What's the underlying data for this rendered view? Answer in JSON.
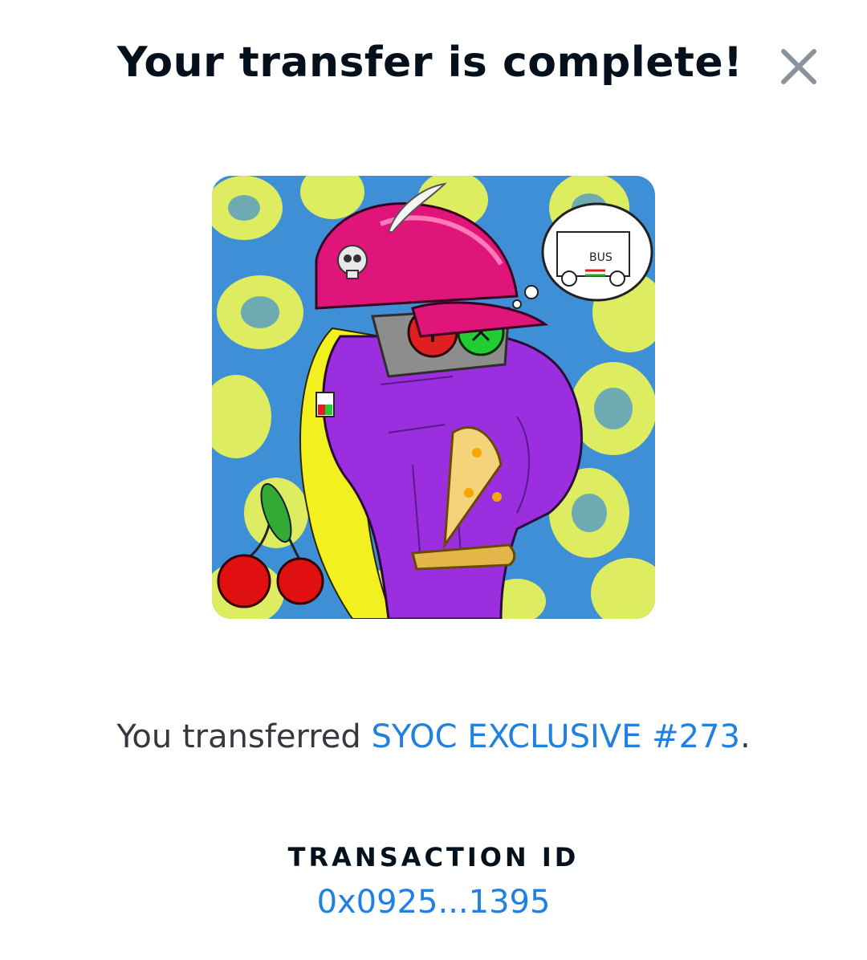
{
  "dialog": {
    "title": "Your transfer is complete!",
    "close_icon": "close-icon"
  },
  "nft": {
    "image_alt": "SYOC EXCLUSIVE #273 artwork",
    "thought_text": "BUS"
  },
  "message": {
    "prefix": "You transferred ",
    "item_name": "SYOC EXCLUSIVE #273",
    "suffix": "."
  },
  "transaction": {
    "label": "TRANSACTION ID",
    "id": "0x0925...1395"
  },
  "colors": {
    "link": "#2081e2",
    "title": "#04111d",
    "body_text": "#353840",
    "close_icon": "#8a939b"
  }
}
